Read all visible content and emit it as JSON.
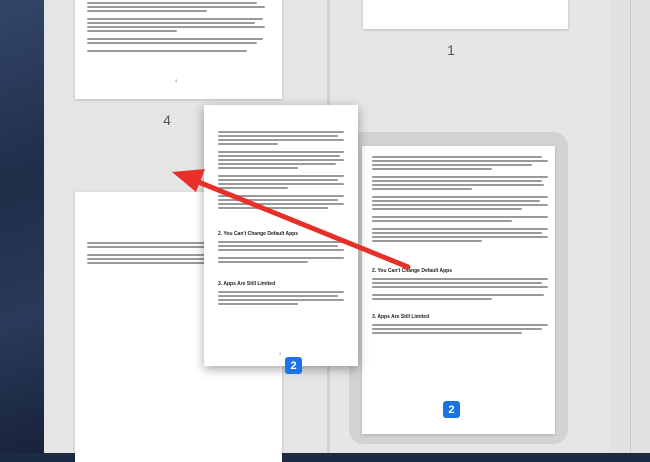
{
  "colors": {
    "arrow": "#e8302a",
    "badge": "#1a73e8"
  },
  "thumbnails": {
    "left_top_folio": "4",
    "left_top_label": "4",
    "right_top_label": "1",
    "dragged_folio": "2",
    "dragged_badge": "2",
    "target_folio": "2",
    "target_badge": "2"
  },
  "dragged_page": {
    "heading_1": "2. You Can't Change Default Apps",
    "heading_2": "3. Apps Are Still Limited"
  },
  "target_page": {
    "heading_1": "2. You Can't Change Default Apps",
    "heading_2": "3. Apps Are Still Limited"
  }
}
